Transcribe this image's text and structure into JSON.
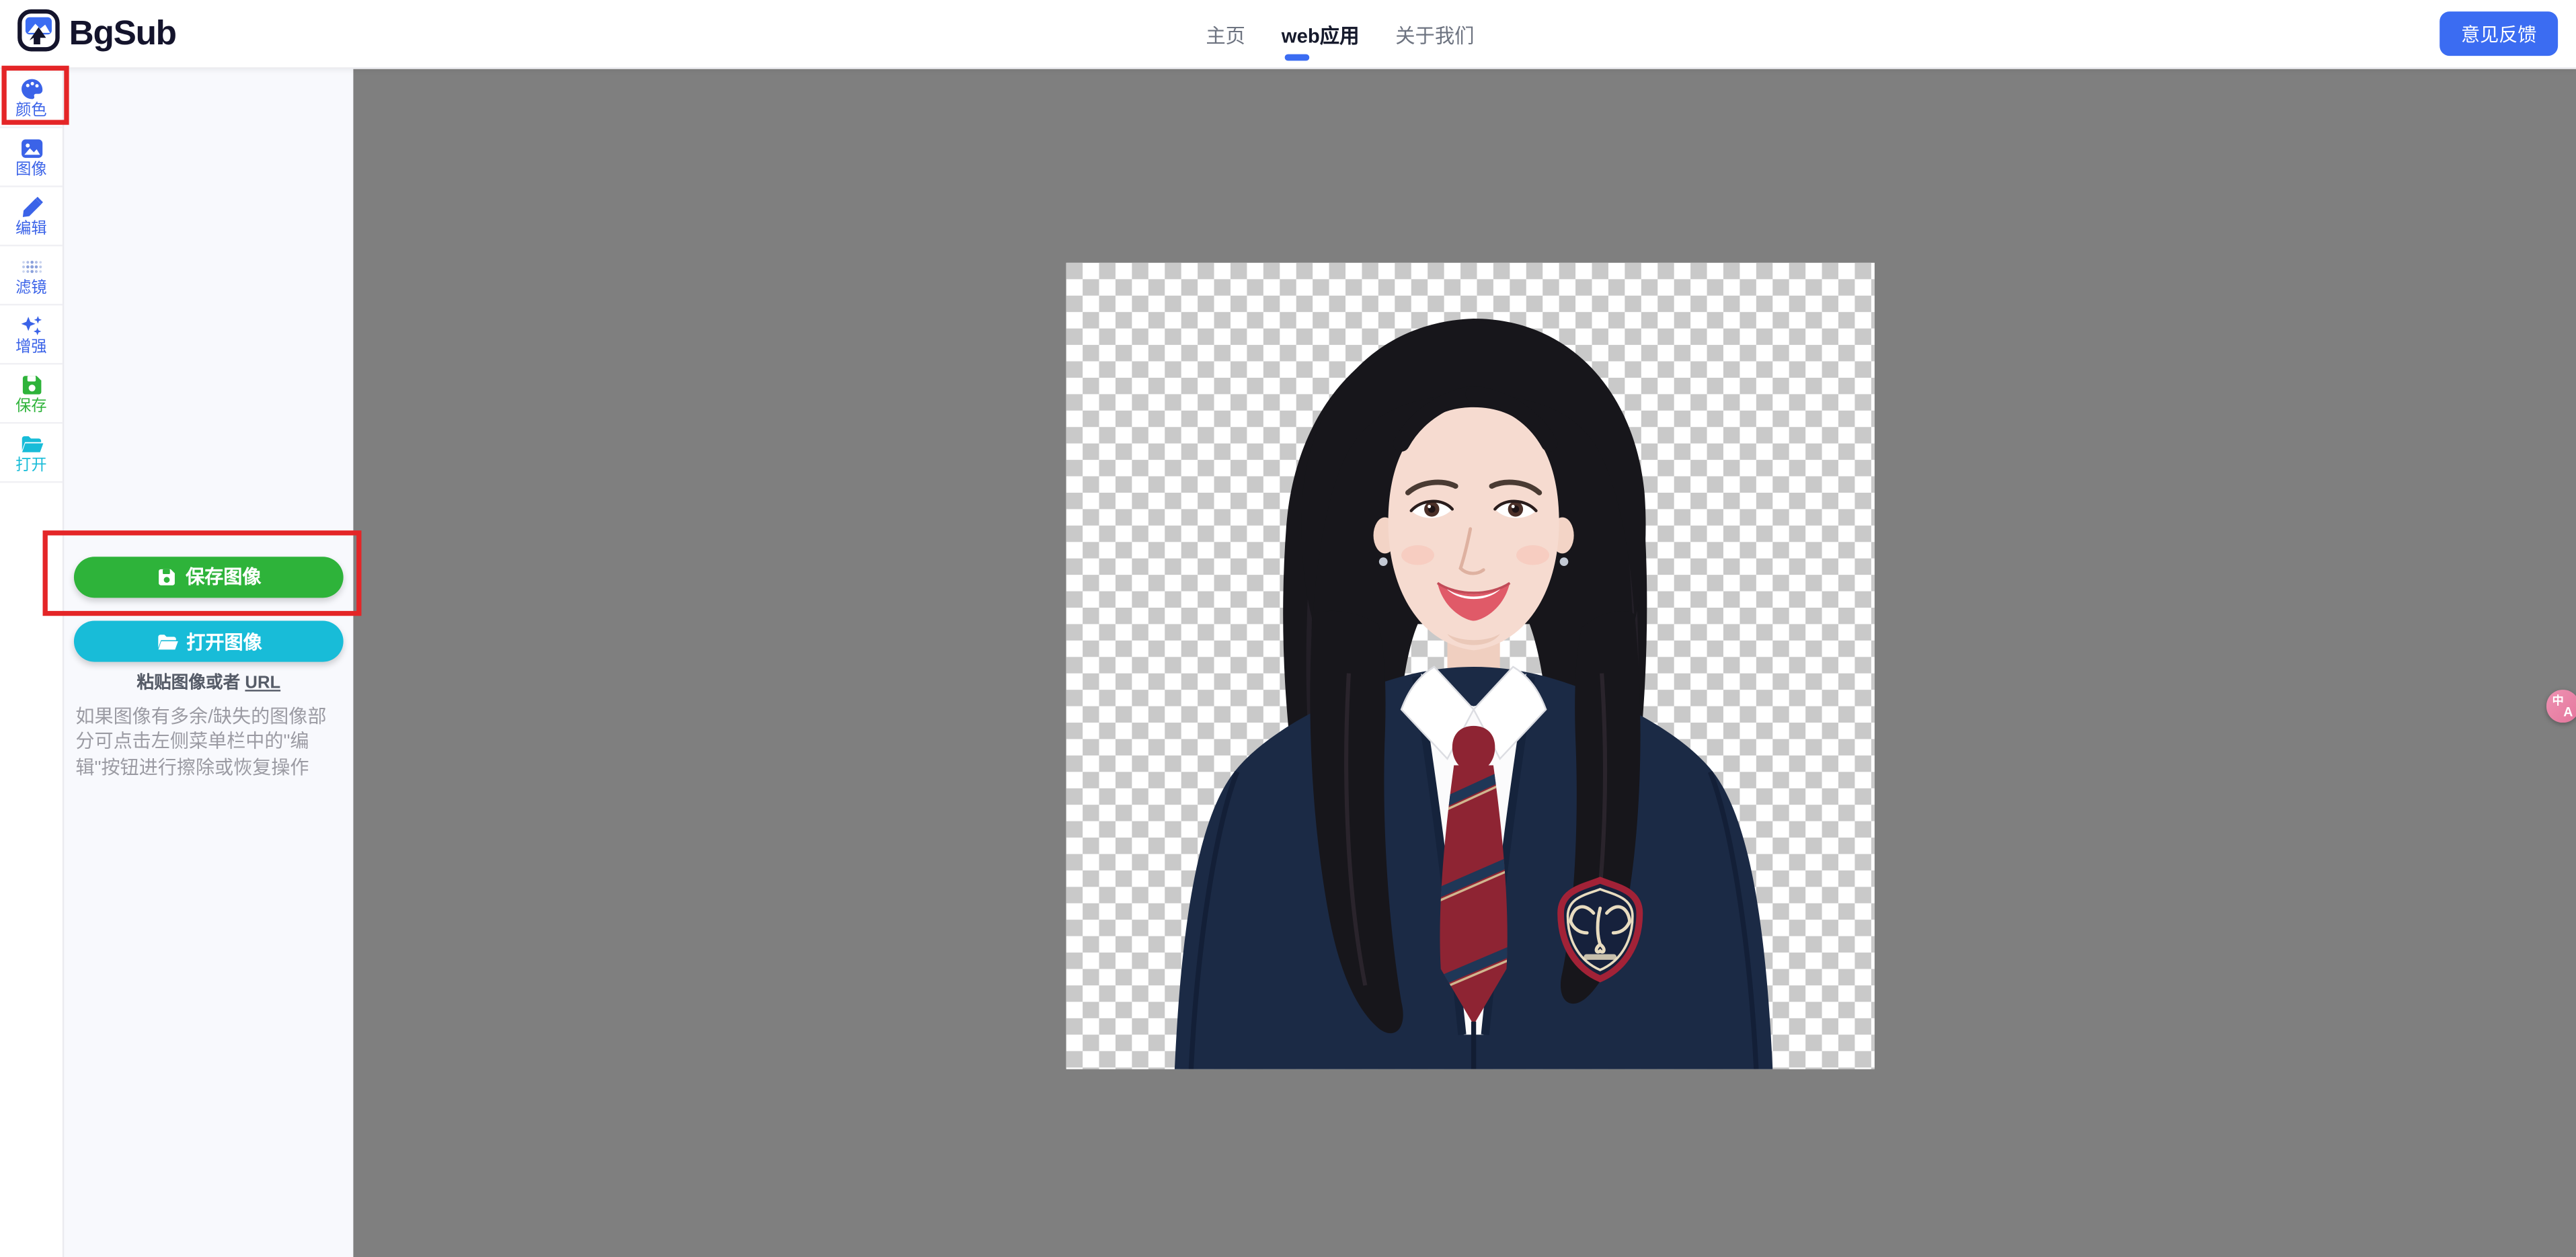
{
  "header": {
    "logo_text": "BgSub",
    "nav": [
      {
        "label": "主页",
        "active": false
      },
      {
        "label": "web应用",
        "active": true
      },
      {
        "label": "关于我们",
        "active": false
      }
    ],
    "feedback_button": "意见反馈"
  },
  "sidebar": {
    "items": [
      {
        "label": "颜色",
        "icon": "palette-icon",
        "color": "#3b63e8",
        "highlighted": true
      },
      {
        "label": "图像",
        "icon": "image-icon",
        "color": "#3b63e8",
        "highlighted": false
      },
      {
        "label": "编辑",
        "icon": "pencil-icon",
        "color": "#3b63e8",
        "highlighted": false
      },
      {
        "label": "滤镜",
        "icon": "filter-dots-icon",
        "color": "#8ba1dc",
        "highlighted": false
      },
      {
        "label": "增强",
        "icon": "sparkles-icon",
        "color": "#3b63e8",
        "highlighted": false
      },
      {
        "label": "保存",
        "icon": "save-icon",
        "color": "#2eb33a",
        "highlighted": false
      },
      {
        "label": "打开",
        "icon": "open-folder-icon",
        "color": "#18bcd8",
        "highlighted": false
      }
    ]
  },
  "panel": {
    "save_button": "保存图像",
    "open_button": "打开图像",
    "paste_hint_prefix": "粘贴图像或者 ",
    "paste_hint_link": "URL",
    "help_text": "如果图像有多余/缺失的图像部分可点击左侧菜单栏中的\"编辑\"按钮进行擦除或恢复操作"
  },
  "canvas": {
    "content": "portrait photo of a woman in navy school-uniform blazer with transparent checkerboard background"
  },
  "fab": {
    "char_top": "中",
    "char_bottom": "A"
  },
  "colors": {
    "accent_blue": "#3b6cf2",
    "sidebar_blue": "#3b63e8",
    "filter_light_blue": "#8ba1dc",
    "save_green": "#2eb33a",
    "open_cyan": "#18bcd8",
    "annotation_red": "#e42527",
    "canvas_gray": "#7f7f7f",
    "panel_bg": "#f8f9fd",
    "checker_gray": "#c9c9c9",
    "fab_pink": "#e87f9f"
  }
}
